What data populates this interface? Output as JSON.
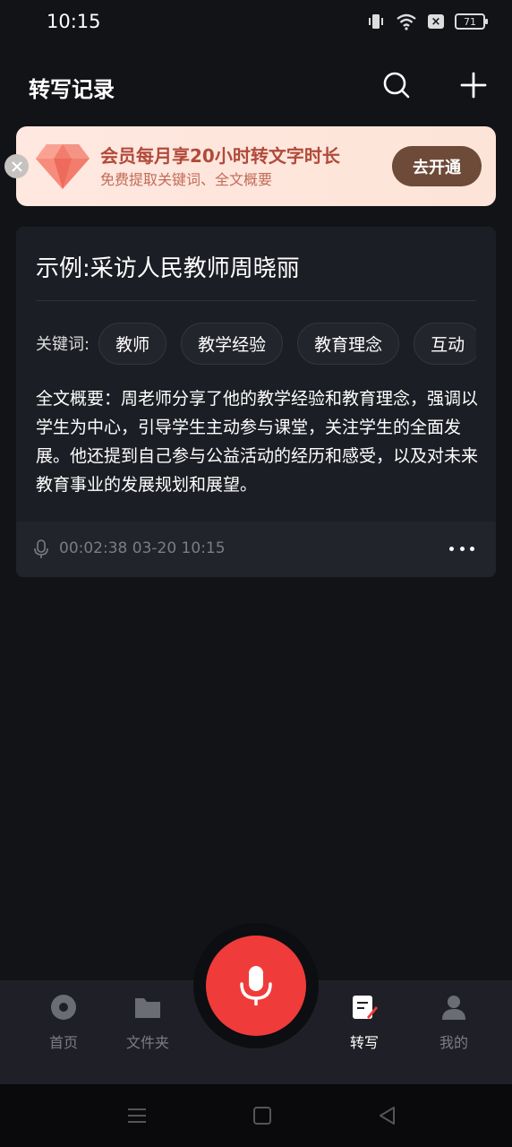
{
  "status_bar": {
    "time": "10:15",
    "battery": "71"
  },
  "header": {
    "title": "转写记录"
  },
  "promo": {
    "title": "会员每月享20小时转文字时长",
    "subtitle": "免费提取关键词、全文概要",
    "button": "去开通"
  },
  "record": {
    "title": "示例:采访人民教师周晓丽",
    "keywords_label": "关键词:",
    "keywords": [
      "教师",
      "教学经验",
      "教育理念",
      "互动"
    ],
    "summary": "全文概要：周老师分享了他的教学经验和教育理念，强调以学生为中心，引导学生主动参与课堂，关注学生的全面发展。他还提到自己参与公益活动的经历和感受，以及对未来教育事业的发展规划和展望。",
    "meta": "00:02:38 03-20 10:15"
  },
  "nav": {
    "items": [
      {
        "label": "首页",
        "icon": "disc-icon"
      },
      {
        "label": "文件夹",
        "icon": "folder-icon"
      },
      {
        "label": "转写",
        "icon": "note-edit-icon"
      },
      {
        "label": "我的",
        "icon": "user-icon"
      }
    ]
  },
  "colors": {
    "background": "#121317",
    "card": "#1c1e25",
    "record_button": "#f03b3b",
    "promo_button": "#6e4a38",
    "promo_text": "#b14a3a"
  }
}
